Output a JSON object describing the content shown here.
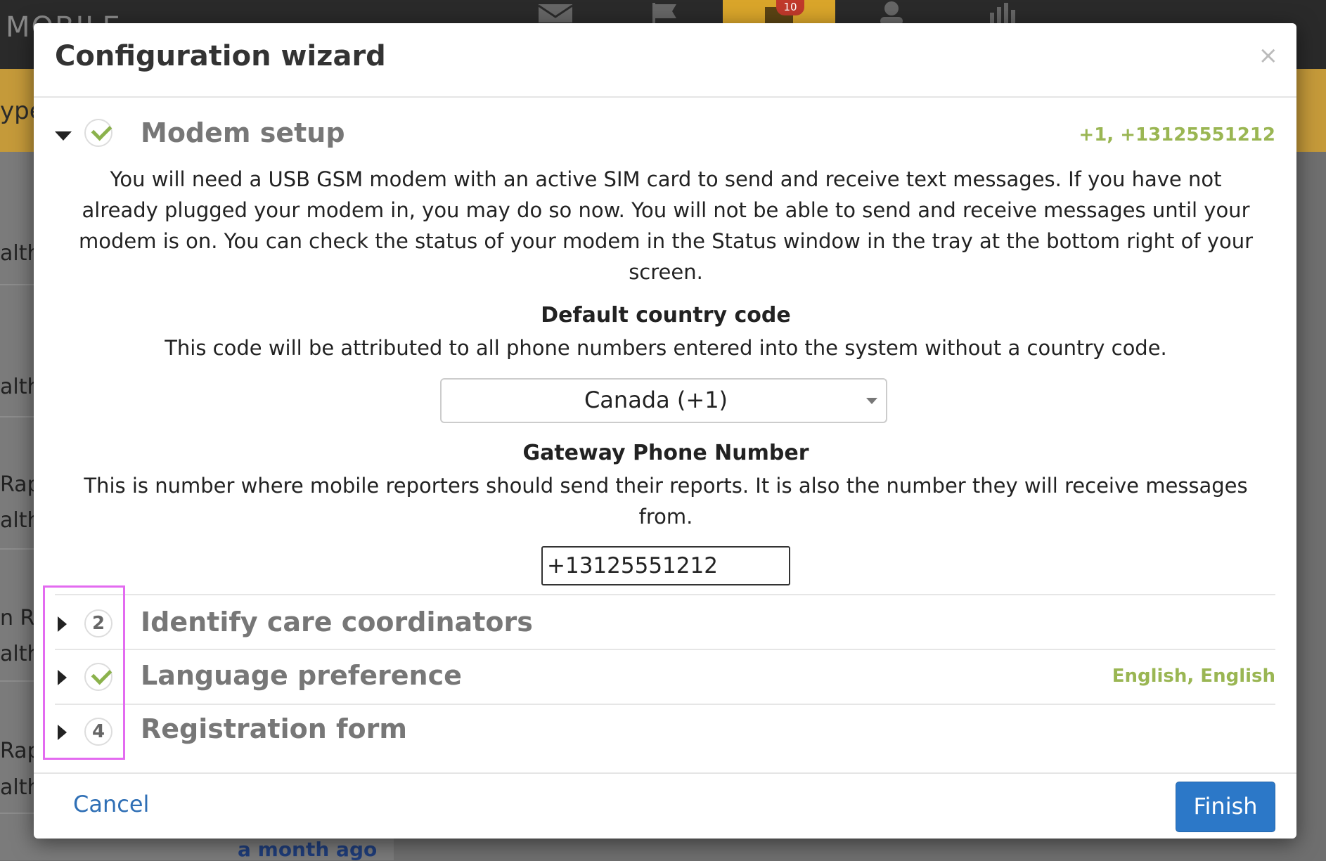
{
  "background": {
    "brand": "MOBILE",
    "nav_badge": "10",
    "band_text": "ypes",
    "list_fragments": [
      "alth",
      "alth",
      "Rap",
      "alth",
      "n Ra",
      "alth",
      "Rap",
      "alth"
    ],
    "footer_time": "a month ago"
  },
  "modal": {
    "title": "Configuration wizard",
    "close_symbol": "×",
    "steps": [
      {
        "title": "Modem setup",
        "summary": "+1, +13125551212",
        "expanded": true,
        "status": "complete",
        "description": "You will need a USB GSM modem with an active SIM card to send and receive text messages. If you have not already plugged your modem in, you may do so now. You will not be able to send and receive messages until your modem is on. You can check the status of your modem in the Status window in the tray at the bottom right of your screen.",
        "country_code": {
          "label": "Default country code",
          "help": "This code will be attributed to all phone numbers entered into the system without a country code.",
          "selected": "Canada (+1)"
        },
        "gateway": {
          "label": "Gateway Phone Number",
          "help": "This is number where mobile reporters should send their reports. It is also the number they will receive messages from.",
          "value": "+13125551212"
        }
      },
      {
        "number": "2",
        "title": "Identify care coordinators",
        "summary": "",
        "status": "incomplete"
      },
      {
        "title": "Language preference",
        "summary": "English, English",
        "status": "complete"
      },
      {
        "number": "4",
        "title": "Registration form",
        "summary": "",
        "status": "incomplete"
      }
    ],
    "footer": {
      "cancel": "Cancel",
      "finish": "Finish"
    }
  },
  "colors": {
    "accent_blue": "#2c78c8",
    "success_green": "#9ab653",
    "highlight_magenta": "#e36bf0"
  }
}
